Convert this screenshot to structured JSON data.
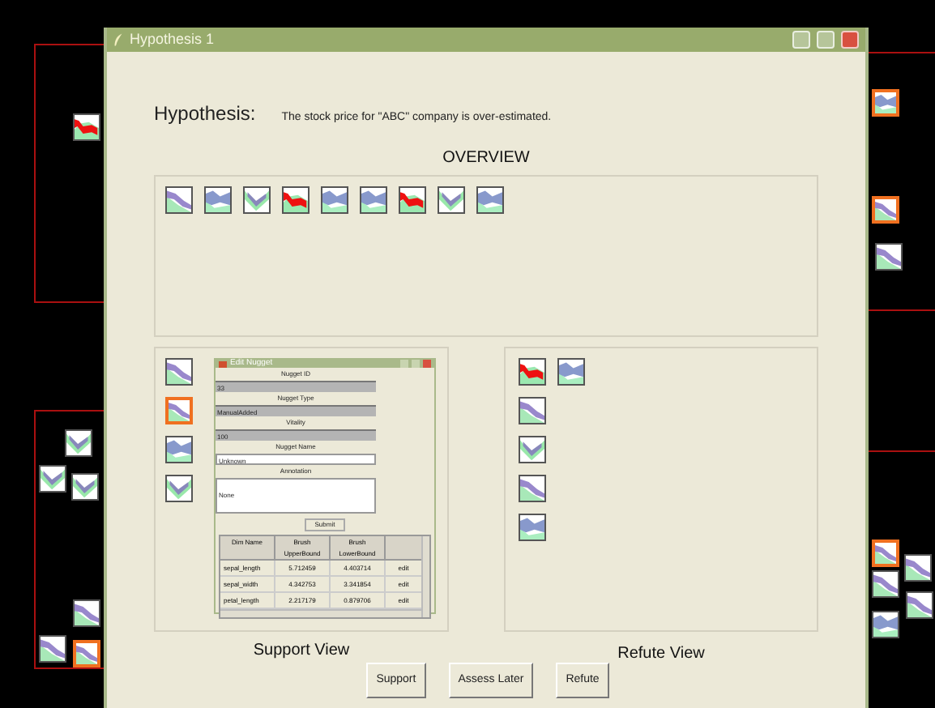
{
  "background": {
    "thumbnails": [
      {
        "kind": "red",
        "selected": false
      },
      {
        "kind": "green",
        "selected": false
      },
      {
        "kind": "green",
        "selected": false
      },
      {
        "kind": "green",
        "selected": false
      },
      {
        "kind": "violet",
        "selected": false
      },
      {
        "kind": "violet",
        "selected": false
      },
      {
        "kind": "violet",
        "selected": true
      },
      {
        "kind": "blue",
        "selected": true
      },
      {
        "kind": "violet",
        "selected": true
      },
      {
        "kind": "violet",
        "selected": false
      },
      {
        "kind": "violet",
        "selected": true
      },
      {
        "kind": "violet",
        "selected": false
      },
      {
        "kind": "violet",
        "selected": false
      },
      {
        "kind": "violet",
        "selected": false
      },
      {
        "kind": "blue",
        "selected": false
      }
    ]
  },
  "window": {
    "title": "Hypothesis 1"
  },
  "hypothesis": {
    "label": "Hypothesis:",
    "text": "The stock price for \"ABC\" company is over-estimated."
  },
  "overview": {
    "title": "OVERVIEW",
    "thumbnails": [
      {
        "kind": "violet",
        "selected": false
      },
      {
        "kind": "blue",
        "selected": false
      },
      {
        "kind": "green",
        "selected": false
      },
      {
        "kind": "red",
        "selected": false
      },
      {
        "kind": "blue",
        "selected": false
      },
      {
        "kind": "blue",
        "selected": false
      },
      {
        "kind": "red",
        "selected": false
      },
      {
        "kind": "green",
        "selected": false
      },
      {
        "kind": "blue",
        "selected": false
      }
    ]
  },
  "support": {
    "title": "Support View",
    "thumbnails": [
      {
        "kind": "violet",
        "selected": false
      },
      {
        "kind": "violet",
        "selected": true
      },
      {
        "kind": "blue",
        "selected": false
      },
      {
        "kind": "green",
        "selected": false
      }
    ]
  },
  "nugget_window": {
    "title": "Edit Nugget",
    "fields": [
      {
        "label": "Nugget ID",
        "value": "33",
        "editable": false
      },
      {
        "label": "Nugget Type",
        "value": "ManualAdded",
        "editable": false
      },
      {
        "label": "Vitality",
        "value": "100",
        "editable": false
      },
      {
        "label": "Nugget Name",
        "value": "Unknown",
        "editable": true
      },
      {
        "label": "Annotation",
        "value": "None",
        "editable": true,
        "kind": "multiline"
      }
    ],
    "submit": "Submit",
    "table": {
      "columns": [
        "Dim Name",
        "Brush UpperBound",
        "Brush LowerBound"
      ],
      "rows": [
        {
          "cells": [
            "sepal_length",
            "5.712459",
            "4.403714"
          ],
          "action": "edit"
        },
        {
          "cells": [
            "sepal_width",
            "4.342753",
            "3.341854"
          ],
          "action": "edit"
        },
        {
          "cells": [
            "petal_length",
            "2.217179",
            "0.879706"
          ],
          "action": "edit"
        }
      ]
    }
  },
  "refute": {
    "title": "Refute View",
    "rows": [
      [
        {
          "kind": "red",
          "selected": false
        },
        {
          "kind": "blue",
          "selected": false
        }
      ],
      [
        {
          "kind": "violet",
          "selected": false
        }
      ],
      [
        {
          "kind": "green",
          "selected": false
        }
      ],
      [
        {
          "kind": "violet",
          "selected": false
        }
      ],
      [
        {
          "kind": "blue",
          "selected": false
        }
      ]
    ]
  },
  "buttons": [
    "Support",
    "Assess Later",
    "Refute"
  ]
}
